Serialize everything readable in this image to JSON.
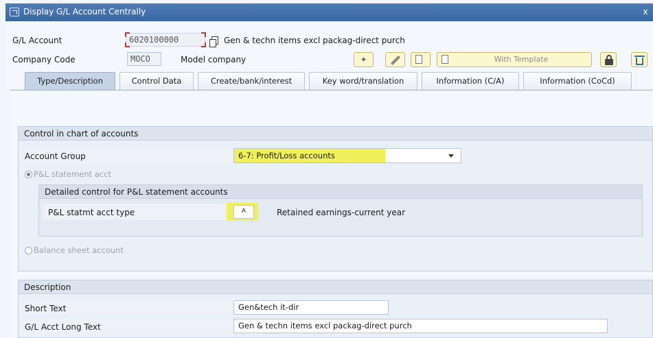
{
  "window": {
    "title": "Display G/L Account Centrally",
    "close_glyph": "x"
  },
  "header": {
    "gl_account_label": "G/L Account",
    "gl_account_value": "6020100000",
    "gl_account_desc": "Gen & techn items excl packag-direct purch",
    "company_code_label": "Company Code",
    "company_code_value": "MOCO",
    "company_name": "Model company",
    "with_template_label": "With Template"
  },
  "tabs": [
    {
      "label": "Type/Description",
      "active": true
    },
    {
      "label": "Control Data",
      "active": false
    },
    {
      "label": "Create/bank/interest",
      "active": false
    },
    {
      "label": "Key word/translation",
      "active": false
    },
    {
      "label": "Information (C/A)",
      "active": false
    },
    {
      "label": "Information (CoCd)",
      "active": false
    }
  ],
  "control": {
    "group_title": "Control in chart of accounts",
    "account_group_label": "Account Group",
    "account_group_value": "6-7: Profit/Loss accounts",
    "pl_radio_label": "P&L statement acct",
    "pl_radio_selected": true,
    "detailed_title": "Detailed control for P&L statement accounts",
    "pl_type_label": "P&L statmt acct type",
    "pl_type_value": "A",
    "pl_type_desc": "Retained earnings-current year",
    "bs_radio_label": "Balance sheet account",
    "bs_radio_selected": false
  },
  "description": {
    "group_title": "Description",
    "short_text_label": "Short Text",
    "short_text_value": "Gen&tech it-dir",
    "long_text_label": "G/L Acct Long Text",
    "long_text_value": "Gen & techn items excl packag-direct purch"
  },
  "colors": {
    "title_bar": "#3f6ea8",
    "highlight": "#f0f05a",
    "active_tab": "#c5d4e6"
  }
}
